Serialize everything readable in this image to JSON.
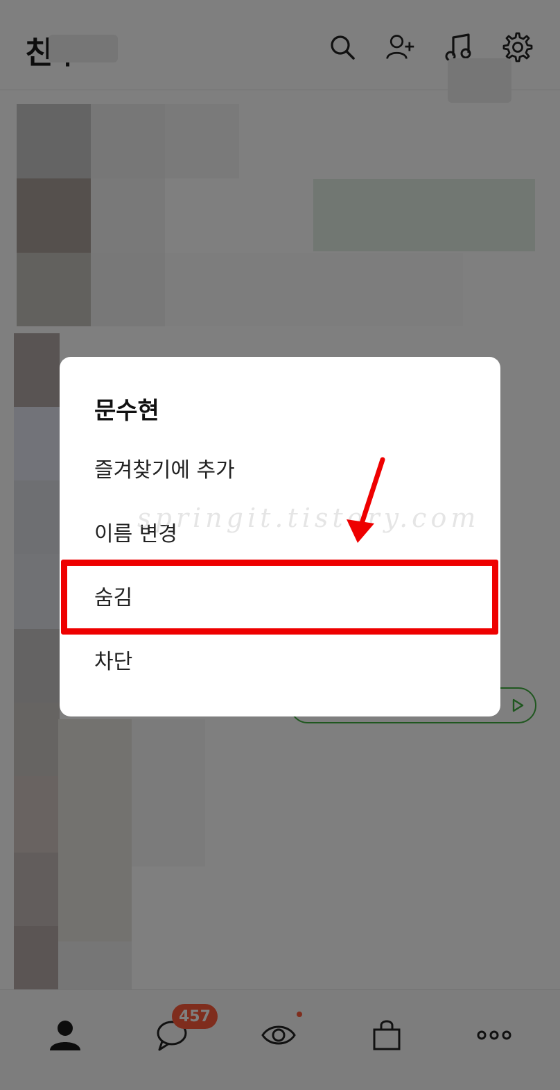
{
  "header": {
    "title": "친구",
    "icons": [
      "search-icon",
      "add-friend-icon",
      "music-icon",
      "settings-icon"
    ]
  },
  "dialog": {
    "title": "문수현",
    "items": [
      {
        "label": "즐겨찾기에 추가"
      },
      {
        "label": "이름 변경"
      },
      {
        "label": "숨김",
        "highlighted": true
      },
      {
        "label": "차단"
      }
    ]
  },
  "watermark": "springit.tistory.com",
  "bottom_nav": {
    "items": [
      "friends-icon",
      "chat-icon",
      "view-icon",
      "shopping-icon",
      "more-icon"
    ],
    "chat_badge": "457"
  },
  "colors": {
    "highlight": "#ee0000",
    "badge": "#ff5a3a",
    "music_pill": "#3fae3f"
  }
}
